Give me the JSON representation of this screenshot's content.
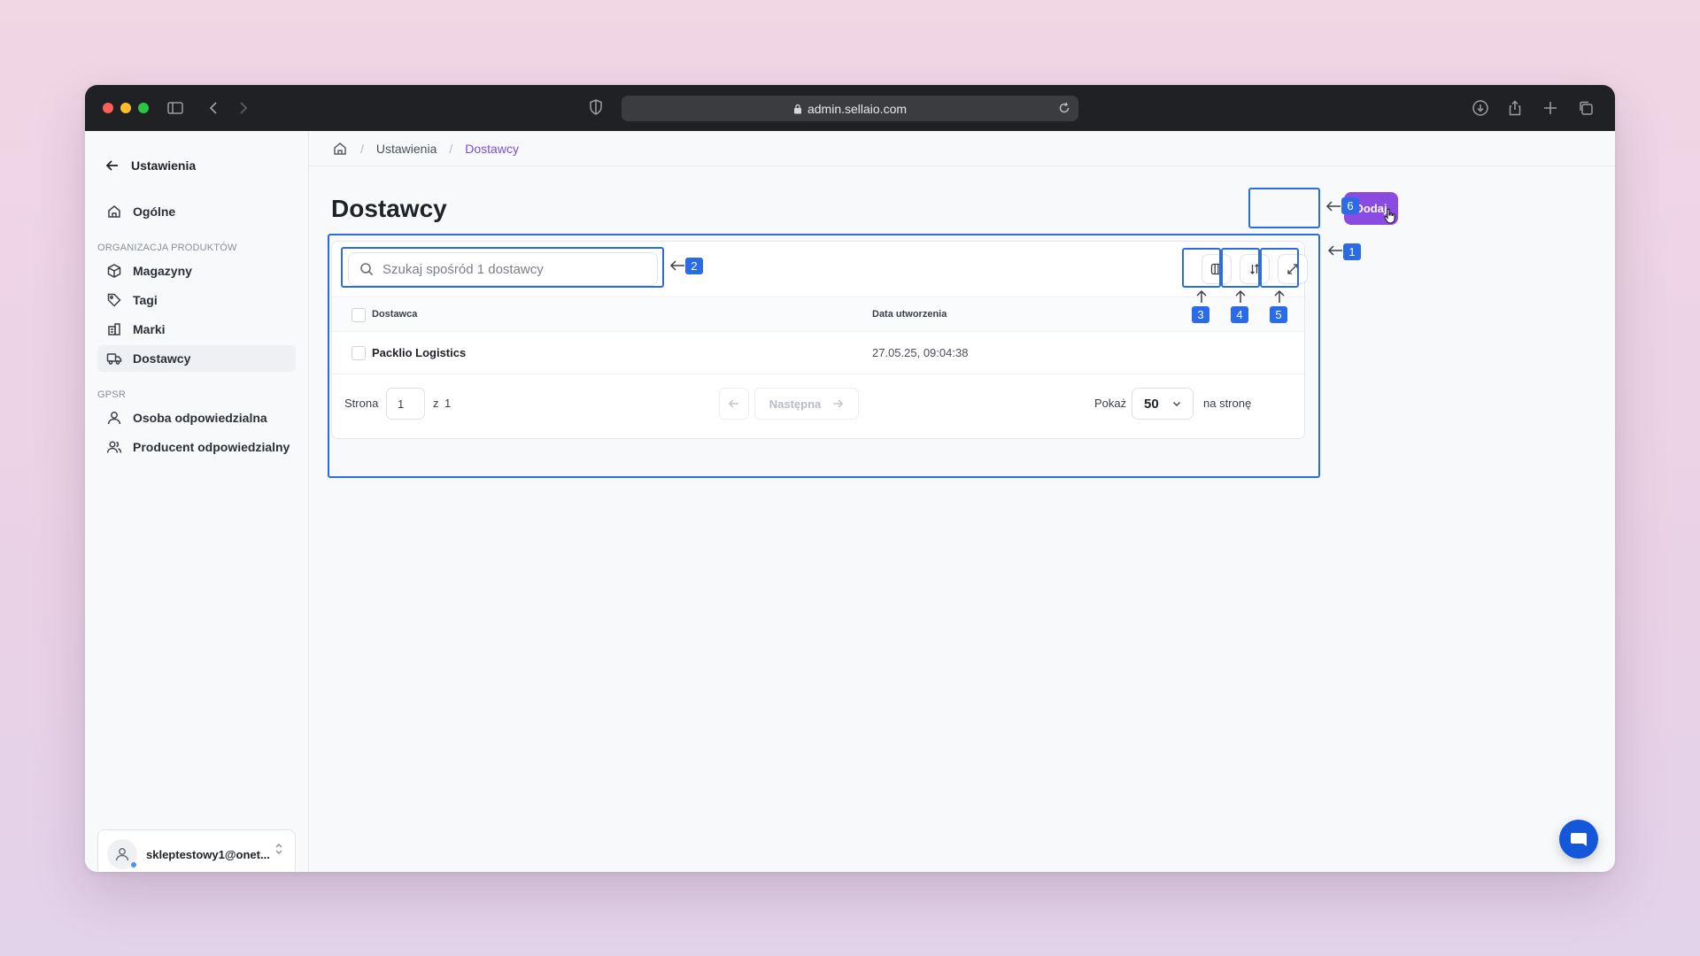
{
  "browser": {
    "url": "admin.sellaio.com"
  },
  "sidebar": {
    "back_label": "Ustawienia",
    "general_label": "Ogólne",
    "section_products": "ORGANIZACJA PRODUKTÓW",
    "items_products": [
      {
        "label": "Magazyny",
        "icon": "box-icon"
      },
      {
        "label": "Tagi",
        "icon": "tag-icon"
      },
      {
        "label": "Marki",
        "icon": "building-icon"
      },
      {
        "label": "Dostawcy",
        "icon": "truck-icon",
        "active": true
      }
    ],
    "section_gpsr": "GPSR",
    "items_gpsr": [
      {
        "label": "Osoba odpowiedzialna",
        "icon": "user-icon"
      },
      {
        "label": "Producent odpowiedzialny",
        "icon": "users-icon"
      }
    ],
    "user_email": "skleptestowy1@onet..."
  },
  "breadcrumb": {
    "items": [
      "Ustawienia",
      "Dostawcy"
    ]
  },
  "page": {
    "title": "Dostawcy",
    "add_button": "Dodaj"
  },
  "table": {
    "search_placeholder": "Szukaj spośród 1 dostawcy",
    "columns": [
      "Dostawca",
      "Data utworzenia"
    ],
    "rows": [
      {
        "supplier": "Packlio Logistics",
        "created": "27.05.25, 09:04:38"
      }
    ],
    "pagination": {
      "page_label": "Strona",
      "page_value": "1",
      "of_label": "z",
      "total_pages": "1",
      "next_label": "Następna",
      "show_label": "Pokaż",
      "per_page": "50",
      "per_page_suffix": "na stronę"
    }
  },
  "annotations": [
    "1",
    "2",
    "3",
    "4",
    "5",
    "6"
  ],
  "colors": {
    "accent": "#8a4ce0",
    "annotation": "#2b6be6",
    "breadcrumb_current": "#7b4fd6"
  }
}
